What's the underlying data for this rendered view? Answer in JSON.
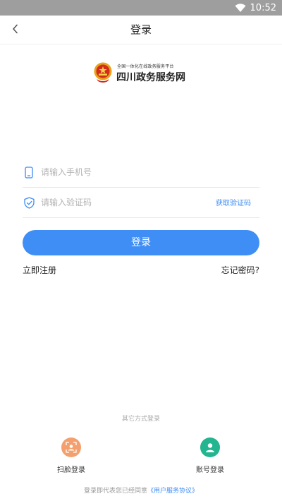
{
  "status_bar": {
    "time": "10:52"
  },
  "nav": {
    "title": "登录"
  },
  "logo": {
    "subtitle": "全国一体化在线政务服务平台",
    "title": "四川政务服务网"
  },
  "form": {
    "phone_placeholder": "请输入手机号",
    "code_placeholder": "请输入验证码",
    "get_code_label": "获取验证码",
    "login_label": "登录"
  },
  "links": {
    "register": "立即注册",
    "forgot_password": "忘记密码?"
  },
  "other_login": {
    "heading": "其它方式登录",
    "methods": [
      {
        "label": "扫脸登录",
        "icon": "face-scan-icon",
        "color": "#f4a06e"
      },
      {
        "label": "账号登录",
        "icon": "user-account-icon",
        "color": "#22b58f"
      }
    ]
  },
  "agreement": {
    "prefix": "登录即代表您已经同意",
    "link": "《用户服务协议》"
  },
  "colors": {
    "accent": "#3f8ef5",
    "status_bar": "#9e9e9e"
  }
}
